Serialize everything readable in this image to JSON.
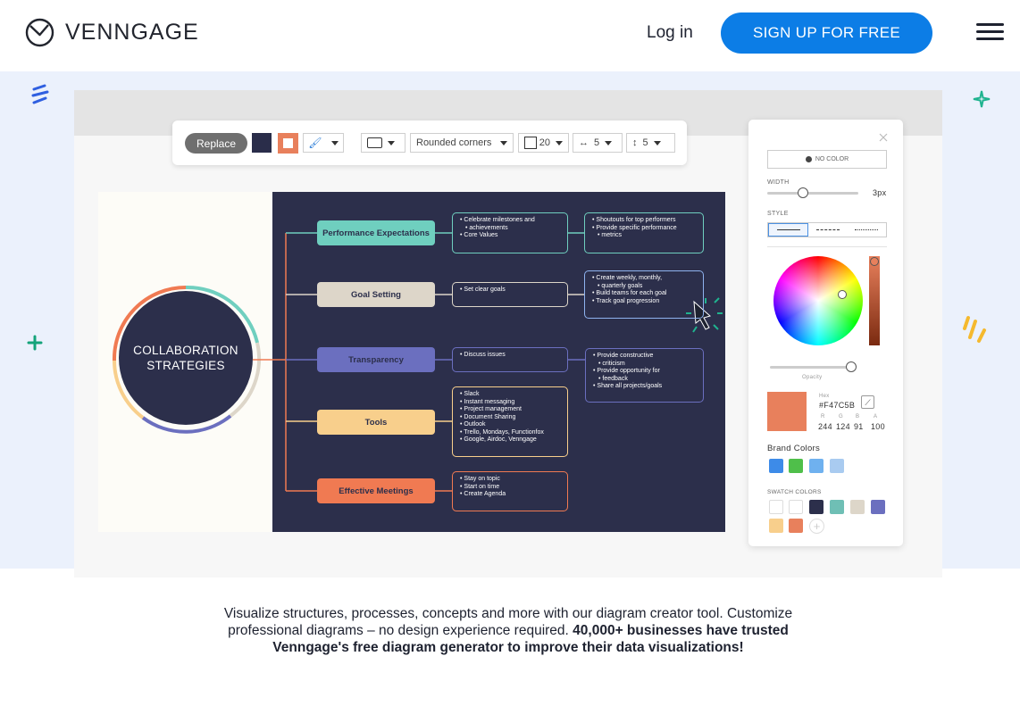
{
  "header": {
    "logo_text": "VENNGAGE",
    "login_label": "Log in",
    "signup_label": "SIGN UP FOR FREE",
    "accent": "#0c7de6"
  },
  "toolbar": {
    "replace_label": "Replace",
    "corner_style": "Rounded corners",
    "corner_radius": "20",
    "h_spacing": "5",
    "v_spacing": "5"
  },
  "diagram": {
    "center_line1": "COLLABORATION",
    "center_line2": "STRATEGIES",
    "nodes": [
      {
        "label": "Performance Expectations",
        "color": "#6fcfbf"
      },
      {
        "label": "Goal Setting",
        "color": "#ddd6c9"
      },
      {
        "label": "Transparency",
        "color": "#6b6fbf"
      },
      {
        "label": "Tools",
        "color": "#f8cf8c"
      },
      {
        "label": "Effective Meetings",
        "color": "#f07a52"
      }
    ],
    "details": [
      [
        "Celebrate milestones and",
        "achievements",
        "Core Values"
      ],
      [
        "Set clear goals"
      ],
      [
        "Discuss issues"
      ],
      [
        "Slack",
        "Instant messaging",
        "Project management",
        "Document Sharing",
        "Outlook",
        "Trello, Mondays, Functionfox",
        "Google, Airdoc, Venngage"
      ],
      [
        "Stay on topic",
        "Start on time",
        "Create Agenda"
      ]
    ],
    "far_details": [
      [
        "Shoutouts for top performers",
        "Provide specific performance",
        "metrics"
      ],
      [
        "Create weekly, monthly,",
        "quarterly goals",
        "Build teams for each goal",
        "Track goal progression"
      ],
      [
        "Provide constructive",
        "criticism",
        "Provide opportunity for",
        "feedback",
        "Share all projects/goals"
      ]
    ]
  },
  "panel": {
    "no_color_label": "NO COLOR",
    "width_label": "WIDTH",
    "width_value": "3px",
    "style_label": "STYLE",
    "opacity_label": "Opacity",
    "hex_label": "Hex",
    "hex_value": "#F47C5B",
    "r_label": "R",
    "g_label": "G",
    "b_label": "B",
    "a_label": "A",
    "r_value": "244",
    "g_value": "124",
    "b_value": "91",
    "a_value": "100",
    "brand_colors_label": "Brand Colors",
    "brand_colors": [
      "#3d8be8",
      "#4fbf4a",
      "#6fb1ef",
      "#a9cbf0"
    ],
    "swatch_label": "SWATCH COLORS",
    "swatch_colors": [
      "#ffffff",
      "#ffffff",
      "#2c2f4b",
      "#6fbfb5",
      "#ddd6c9",
      "#6b6fbf",
      "#f8cf8c",
      "#e8805c"
    ],
    "selected_color": "#e8805c"
  },
  "description": {
    "text_plain": "Visualize structures, processes, concepts and more with our diagram creator tool. Customize professional diagrams – no design experience required.",
    "text_bold": "40,000+ businesses have trusted Venngage's free diagram generator to improve their data visualizations!"
  }
}
